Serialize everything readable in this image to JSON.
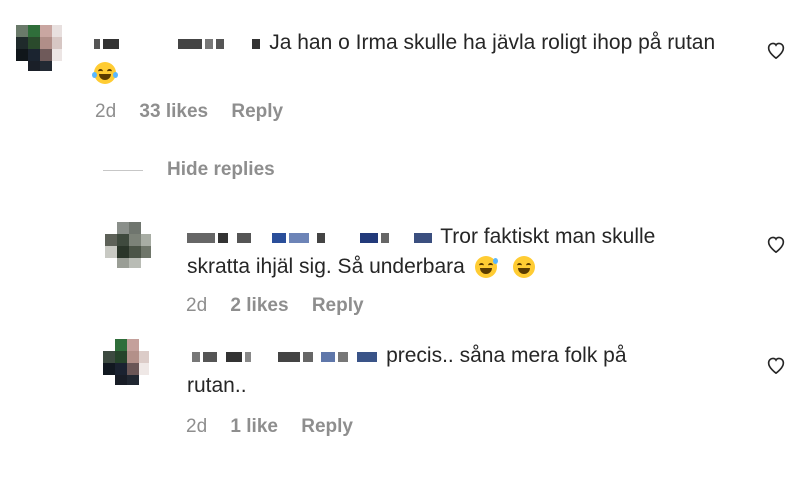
{
  "comments": [
    {
      "text_line1": "Ja han o Irma skulle ha jävla roligt ihop på rutan",
      "text_line2": "",
      "time": "2d",
      "likes": "33 likes",
      "reply": "Reply"
    }
  ],
  "hide_replies": "Hide replies",
  "replies": [
    {
      "text_line1": "Tror faktiskt man skulle",
      "text_line2": "skratta ihjäl sig. Så underbara",
      "time": "2d",
      "likes": "2 likes",
      "reply": "Reply"
    },
    {
      "text_line1": "precis.. såna mera folk på",
      "text_line2": "rutan..",
      "time": "2d",
      "likes": "1 like",
      "reply": "Reply"
    }
  ],
  "icons": {
    "like": "heart-icon",
    "emoji_tears": "face-with-tears-of-joy-emoji",
    "emoji_sweat": "grinning-face-with-sweat-emoji",
    "emoji_squint": "grinning-squinting-face-emoji"
  },
  "colors": {
    "text": "#262626",
    "secondary": "#8e8e8e",
    "divider": "#c7c7c7",
    "emoji": "#ffcc33"
  }
}
